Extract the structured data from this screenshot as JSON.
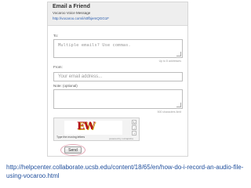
{
  "dialog": {
    "title": "Email a Friend",
    "subtitle": "Vocaroo Voice Message",
    "link": "http://vocaroo.com/i/s0fbjemQGG1F"
  },
  "form": {
    "to_label": "To:",
    "to_placeholder": "Multiple emails? Use commas.",
    "to_hint": "Up to 8 addresses",
    "from_label": "From:",
    "from_placeholder": "Your email address...",
    "note_label": "Note: (optional)",
    "note_hint": "500 characters limit"
  },
  "captcha": {
    "text": "EW",
    "instruction": "Type the moving letters",
    "powered_by": "powered by nuCaptcha",
    "refresh_icon": "refresh-icon",
    "audio_icon": "audio-icon",
    "help_icon": "help-icon"
  },
  "buttons": {
    "send": "Send"
  },
  "caption": {
    "url": "http://helpcenter.collaborate.ucsb.edu/content/18/65/en/how-do-i-record-an-audio-file-using-vocaroo.html"
  },
  "colors": {
    "link": "#2a5db0",
    "caption_link": "#1f4e9c",
    "highlight": "#e2a6b4",
    "captcha_text": "#b3121a"
  }
}
